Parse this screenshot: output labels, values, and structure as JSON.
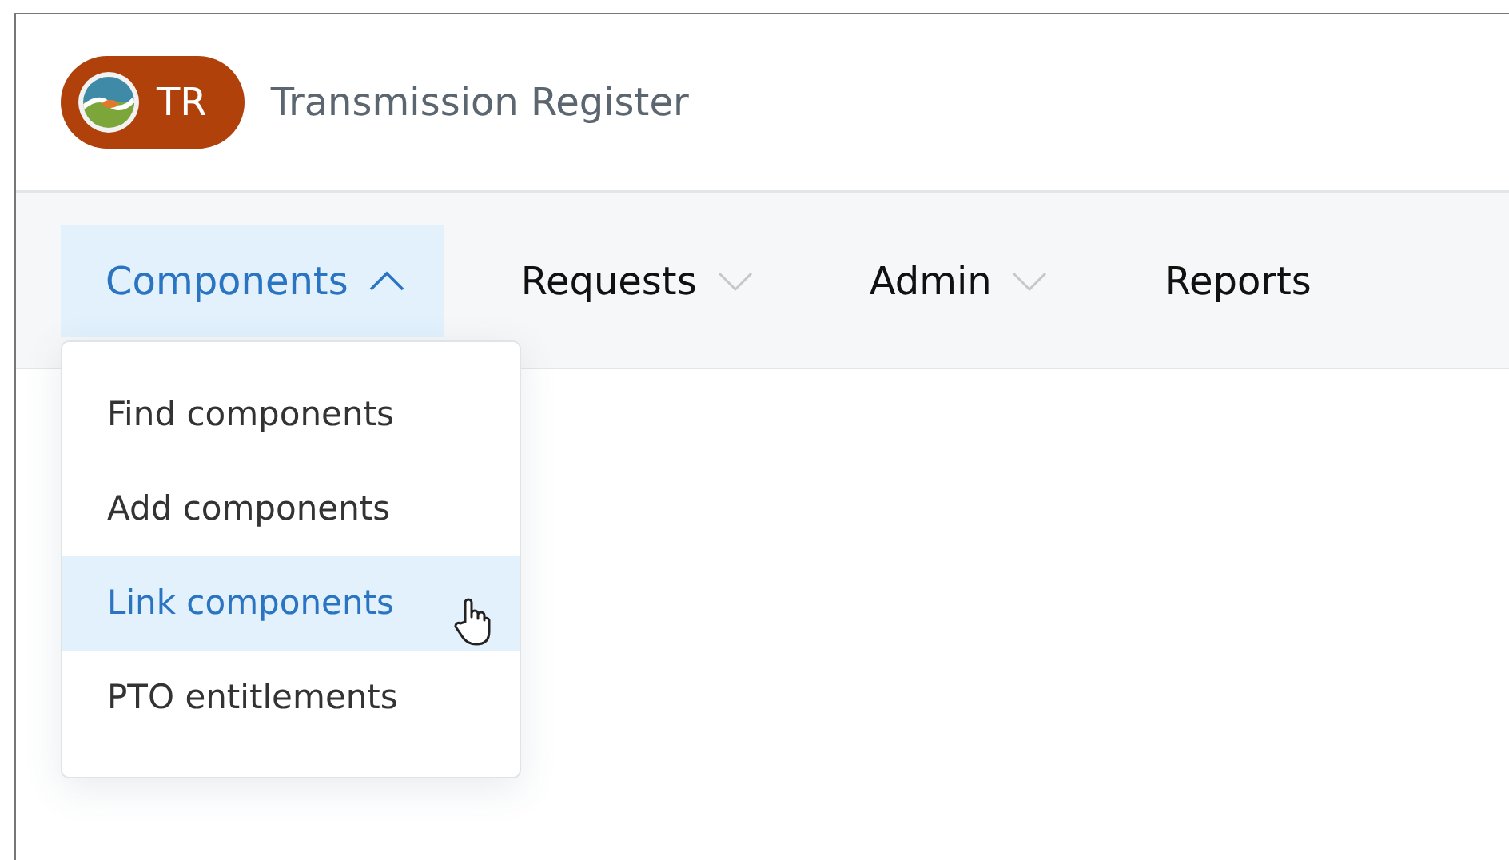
{
  "header": {
    "badge": "TR",
    "title": "Transmission Register"
  },
  "nav": [
    {
      "label": "Components",
      "kind": "menu",
      "expanded": true,
      "selected": true,
      "menu": [
        {
          "label": "Find components",
          "selected": false
        },
        {
          "label": "Add components",
          "selected": false
        },
        {
          "label": "Link components",
          "selected": true
        },
        {
          "label": "PTO entitlements",
          "selected": false
        }
      ]
    },
    {
      "label": "Requests",
      "kind": "menu",
      "expanded": false,
      "selected": false
    },
    {
      "label": "Admin",
      "kind": "menu",
      "expanded": false,
      "selected": false
    },
    {
      "label": "Reports",
      "kind": "link",
      "selected": false
    }
  ]
}
